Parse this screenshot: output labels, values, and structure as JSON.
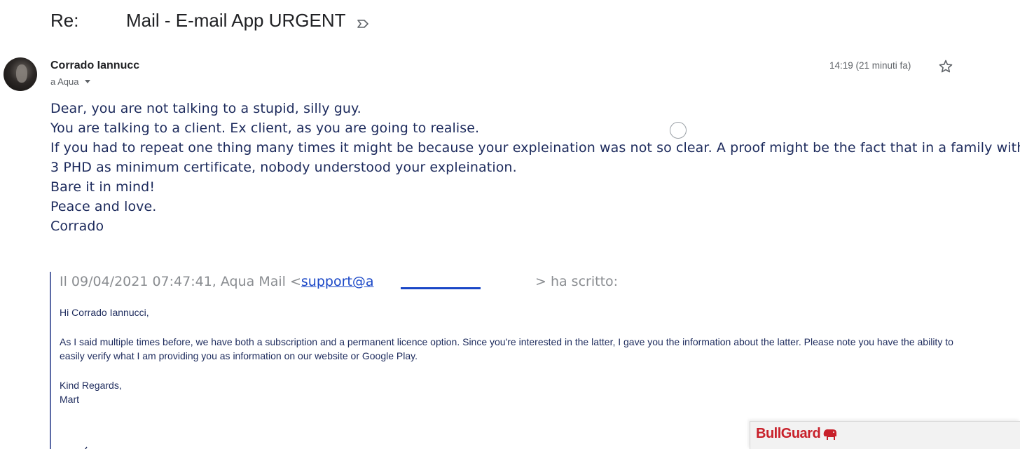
{
  "header": {
    "subject_prefix": "Re:",
    "subject": "Mail - E-mail App URGENT"
  },
  "message": {
    "sender_name": "Corrado Iannucc",
    "recipient": "a Aqua",
    "timestamp": "14:19 (21 minuti fa)",
    "body_lines": [
      "Dear, you are not talking to a stupid, silly guy.",
      "You are talking to a client.  Ex client, as you are going to realise.",
      "If you had to repeat one thing many times it might be because your expleination was not so clear. A proof might be the fact that in a family with",
      "3 PHD as minimum certificate, nobody understood your expleination.",
      "Bare it in mind!",
      "Peace and love.",
      "Corrado"
    ]
  },
  "quote": {
    "header_prefix": "Il 09/04/2021 07:47:41, Aqua Mail <",
    "header_link": "support@a",
    "header_suffix": "> ha scritto:",
    "greeting": "Hi Corrado Iannucci,",
    "paragraph": "As I said multiple times before, we have both a subscription and a permanent licence option. Since you're interested in the latter, I gave you the information about the latter. Please note you have the ability to easily verify what I am providing you as information on our website or Google Play.",
    "regards": "Kind Regards,",
    "signature": "Mart"
  },
  "bullguard": {
    "logo_text": "BullGuard"
  },
  "colors": {
    "body_text": "#1c2a5c",
    "link": "#1a47c7",
    "quote_bar": "#5b6aa6",
    "brand_red": "#c8202a"
  },
  "icons": [
    "important-marker-icon",
    "star-icon",
    "caret-down-icon",
    "bulldog-icon"
  ]
}
